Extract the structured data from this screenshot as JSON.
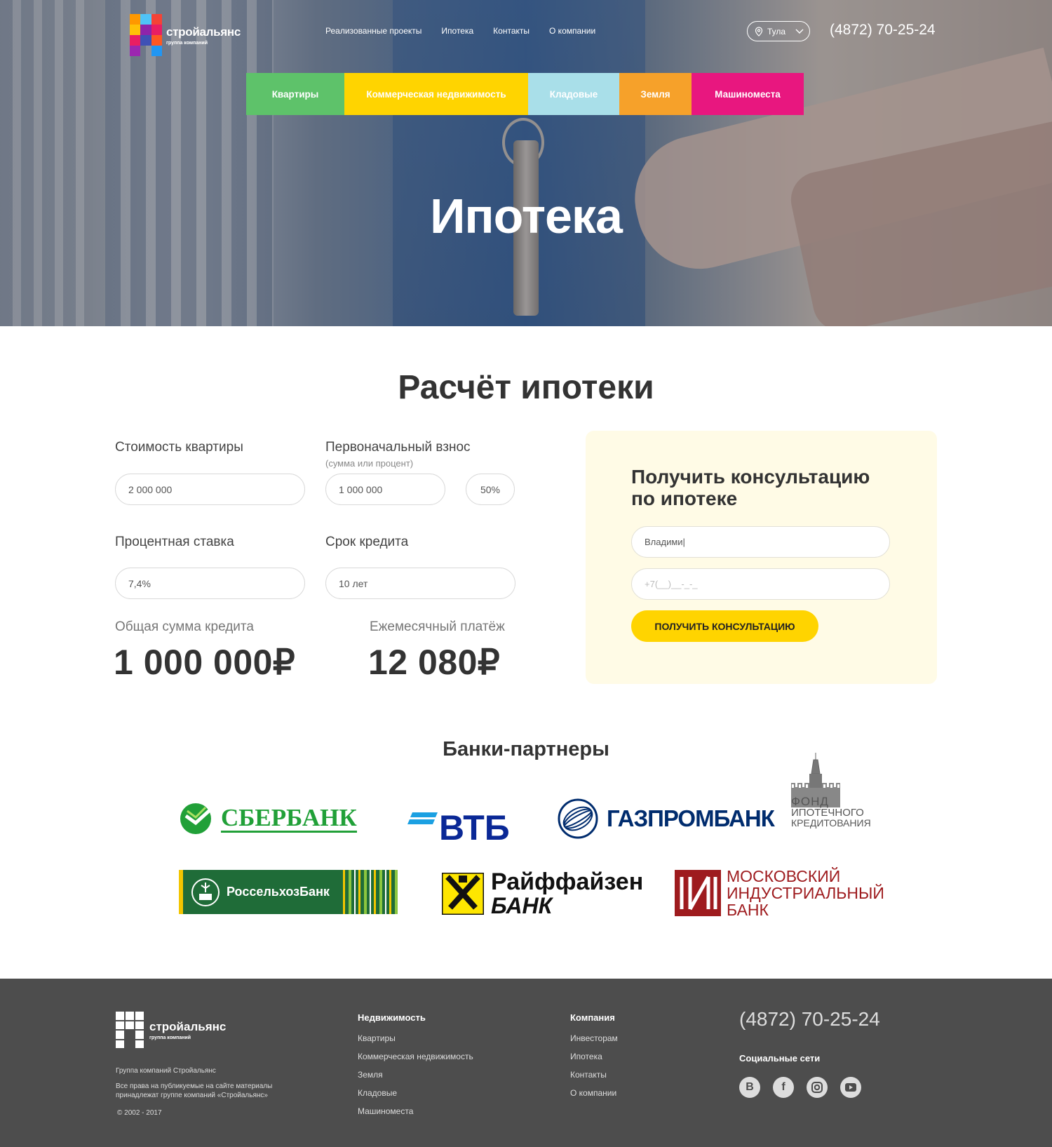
{
  "header": {
    "logo_name": "стройальянс",
    "logo_sub": "группа компаний",
    "nav": [
      "Реализованные проекты",
      "Ипотека",
      "Контакты",
      "О компании"
    ],
    "city": "Тула",
    "phone": "(4872) 70-25-24",
    "categories": [
      {
        "label": "Квартиры",
        "color": "#5ec26a"
      },
      {
        "label": "Коммерческая недвижимость",
        "color": "#ffd400"
      },
      {
        "label": "Кладовые",
        "color": "#a9dfe9"
      },
      {
        "label": "Земля",
        "color": "#f6a12a"
      },
      {
        "label": "Машиноместа",
        "color": "#e8177f"
      }
    ],
    "title": "Ипотека"
  },
  "calc": {
    "title": "Расчёт ипотеки",
    "price_label": "Стоимость квартиры",
    "price_value": "2 000 000",
    "down_label": "Первоначальный взнос",
    "down_sub": "(сумма или процент)",
    "down_value": "1 000 000",
    "down_percent": "50%",
    "rate_label": "Процентная ставка",
    "rate_value": "7,4%",
    "term_label": "Срок кредита",
    "term_value": "10 лет",
    "total_label": "Общая сумма кредита",
    "total_value": "1 000 000₽",
    "monthly_label": "Ежемесячный платёж",
    "monthly_value": "12 080₽"
  },
  "consult": {
    "title": "Получить консультацию по ипотеке",
    "name_value": "Владими|",
    "phone_placeholder": "+7(__)__-_-_",
    "button": "ПОЛУЧИТЬ КОНСУЛЬТАЦИЮ"
  },
  "banks": {
    "title": "Банки-партнеры",
    "sber": "СБЕРБАНК",
    "vtb": "ВТБ",
    "gazprom": "ГАЗПРОМБАНК",
    "fond": [
      "ФОНД",
      "ИПОТЕЧНОГО",
      "КРЕДИТОВАНИЯ"
    ],
    "rosselhoz": "РоссельхозБанк",
    "raif": [
      "Райффайзен",
      "БАНК"
    ],
    "mib": [
      "МОСКОВСКИЙ",
      "ИНДУСТРИАЛЬНЫЙ",
      "БАНК"
    ]
  },
  "footer": {
    "logo_name": "стройальянс",
    "logo_sub": "группа компаний",
    "company": "Группа компаний Стройальянс",
    "rights": "Все права на публикуемые на сайте материалы принадлежат группе компаний «Стройальянс»",
    "copyright": "© 2002 - 2017",
    "col1_title": "Недвижимость",
    "col1": [
      "Квартиры",
      "Коммерческая недвижимость",
      "Земля",
      "Кладовые",
      "Машиноместа"
    ],
    "col2_title": "Компания",
    "col2": [
      "Инвесторам",
      "Ипотека",
      "Контакты",
      "О компании"
    ],
    "phone": "(4872) 70-25-24",
    "social_title": "Социальные сети",
    "social": [
      "vk-icon",
      "facebook-icon",
      "instagram-icon",
      "youtube-icon"
    ]
  }
}
